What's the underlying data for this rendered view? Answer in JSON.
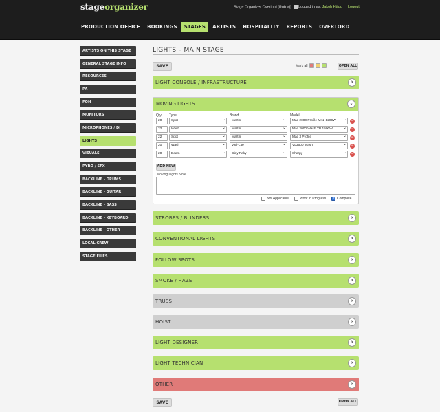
{
  "header": {
    "logo_part1": "stage",
    "logo_part2": "organizer",
    "account_label": "Stage Organizer Overlord (Rob aj)",
    "logged_in_prefix": "Logged in as:",
    "user_name": "Jakob Hägg",
    "logout_label": "Logout"
  },
  "nav": [
    {
      "label": "PRODUCTION OFFICE"
    },
    {
      "label": "BOOKINGS"
    },
    {
      "label": "STAGES",
      "active": true
    },
    {
      "label": "ARTISTS"
    },
    {
      "label": "HOSPITALITY"
    },
    {
      "label": "REPORTS"
    },
    {
      "label": "OVERLORD"
    }
  ],
  "sidebar": {
    "items": [
      {
        "label": "ARTISTS ON THIS STAGE"
      },
      {
        "label": "GENERAL STAGE INFO"
      },
      {
        "label": "RESOURCES"
      },
      {
        "label": "PA"
      },
      {
        "label": "FOH"
      },
      {
        "label": "MONITORS"
      },
      {
        "label": "MICROPHONES / DI"
      },
      {
        "label": "LIGHTS",
        "active": true
      },
      {
        "label": "VISUALS"
      },
      {
        "label": "PYRO / SFX"
      },
      {
        "label": "BACKLINE - DRUMS"
      },
      {
        "label": "BACKLINE - GUITAR"
      },
      {
        "label": "BACKLINE - BASS"
      },
      {
        "label": "BACKLINE - KEYBOARD"
      },
      {
        "label": "BACKLINE - OTHER"
      },
      {
        "label": "LOCAL CREW"
      },
      {
        "label": "STAGE FILES"
      }
    ]
  },
  "main": {
    "title": "LIGHTS  –  MAIN STAGE",
    "save_label": "SAVE",
    "mark_all_label": "Mark all",
    "open_all_label": "OPEN ALL",
    "sections": [
      {
        "label": "LIGHT CONSOLE / INFRASTRUCTURE",
        "status": "green"
      },
      {
        "label": "MOVING LIGHTS",
        "status": "green",
        "expanded": true
      },
      {
        "label": "STROBES / BLINDERS",
        "status": "green"
      },
      {
        "label": "CONVENTIONAL LIGHTS",
        "status": "green"
      },
      {
        "label": "FOLLOW SPOTS",
        "status": "green"
      },
      {
        "label": "SMOKE / HAZE",
        "status": "green"
      },
      {
        "label": "TRUSS",
        "status": "gray"
      },
      {
        "label": "HOIST",
        "status": "gray"
      },
      {
        "label": "LIGHT DESIGNER",
        "status": "green"
      },
      {
        "label": "LIGHT TECHNICIAN",
        "status": "green"
      },
      {
        "label": "OTHER",
        "status": "red"
      }
    ],
    "moving_lights": {
      "columns": {
        "qty": "Qty",
        "type": "Type",
        "brand": "Brand",
        "model": "Model"
      },
      "rows": [
        {
          "qty": "20",
          "type": "Spot",
          "brand": "Martin",
          "model": "Mac 2000 Profile MK2 1200W"
        },
        {
          "qty": "22",
          "type": "Wash",
          "brand": "Martin",
          "model": "Mac 2000 Wash XB 1500W"
        },
        {
          "qty": "22",
          "type": "Spot",
          "brand": "Martin",
          "model": "Mac 3 Profile"
        },
        {
          "qty": "20",
          "type": "Wash",
          "brand": "Vari*Lite",
          "model": "VL3500 Wash"
        },
        {
          "qty": "20",
          "type": "Beam",
          "brand": "Clay Paky",
          "model": "Sharpy"
        }
      ],
      "add_new_label": "ADD NEW",
      "note_label": "Moving Lights Note",
      "note_value": "",
      "checkboxes": [
        {
          "label": "Not Applicable",
          "checked": false
        },
        {
          "label": "Work in Progress",
          "checked": false
        },
        {
          "label": "Complete",
          "checked": true
        }
      ]
    }
  },
  "icons": {
    "chevron_right": "›",
    "chevron_down": "⌄",
    "remove": "−"
  },
  "colors": {
    "accent_green": "#b6e06f",
    "status_gray": "#cfcfcf",
    "status_red": "#e07a78",
    "header_bg": "#1d1d1d"
  }
}
